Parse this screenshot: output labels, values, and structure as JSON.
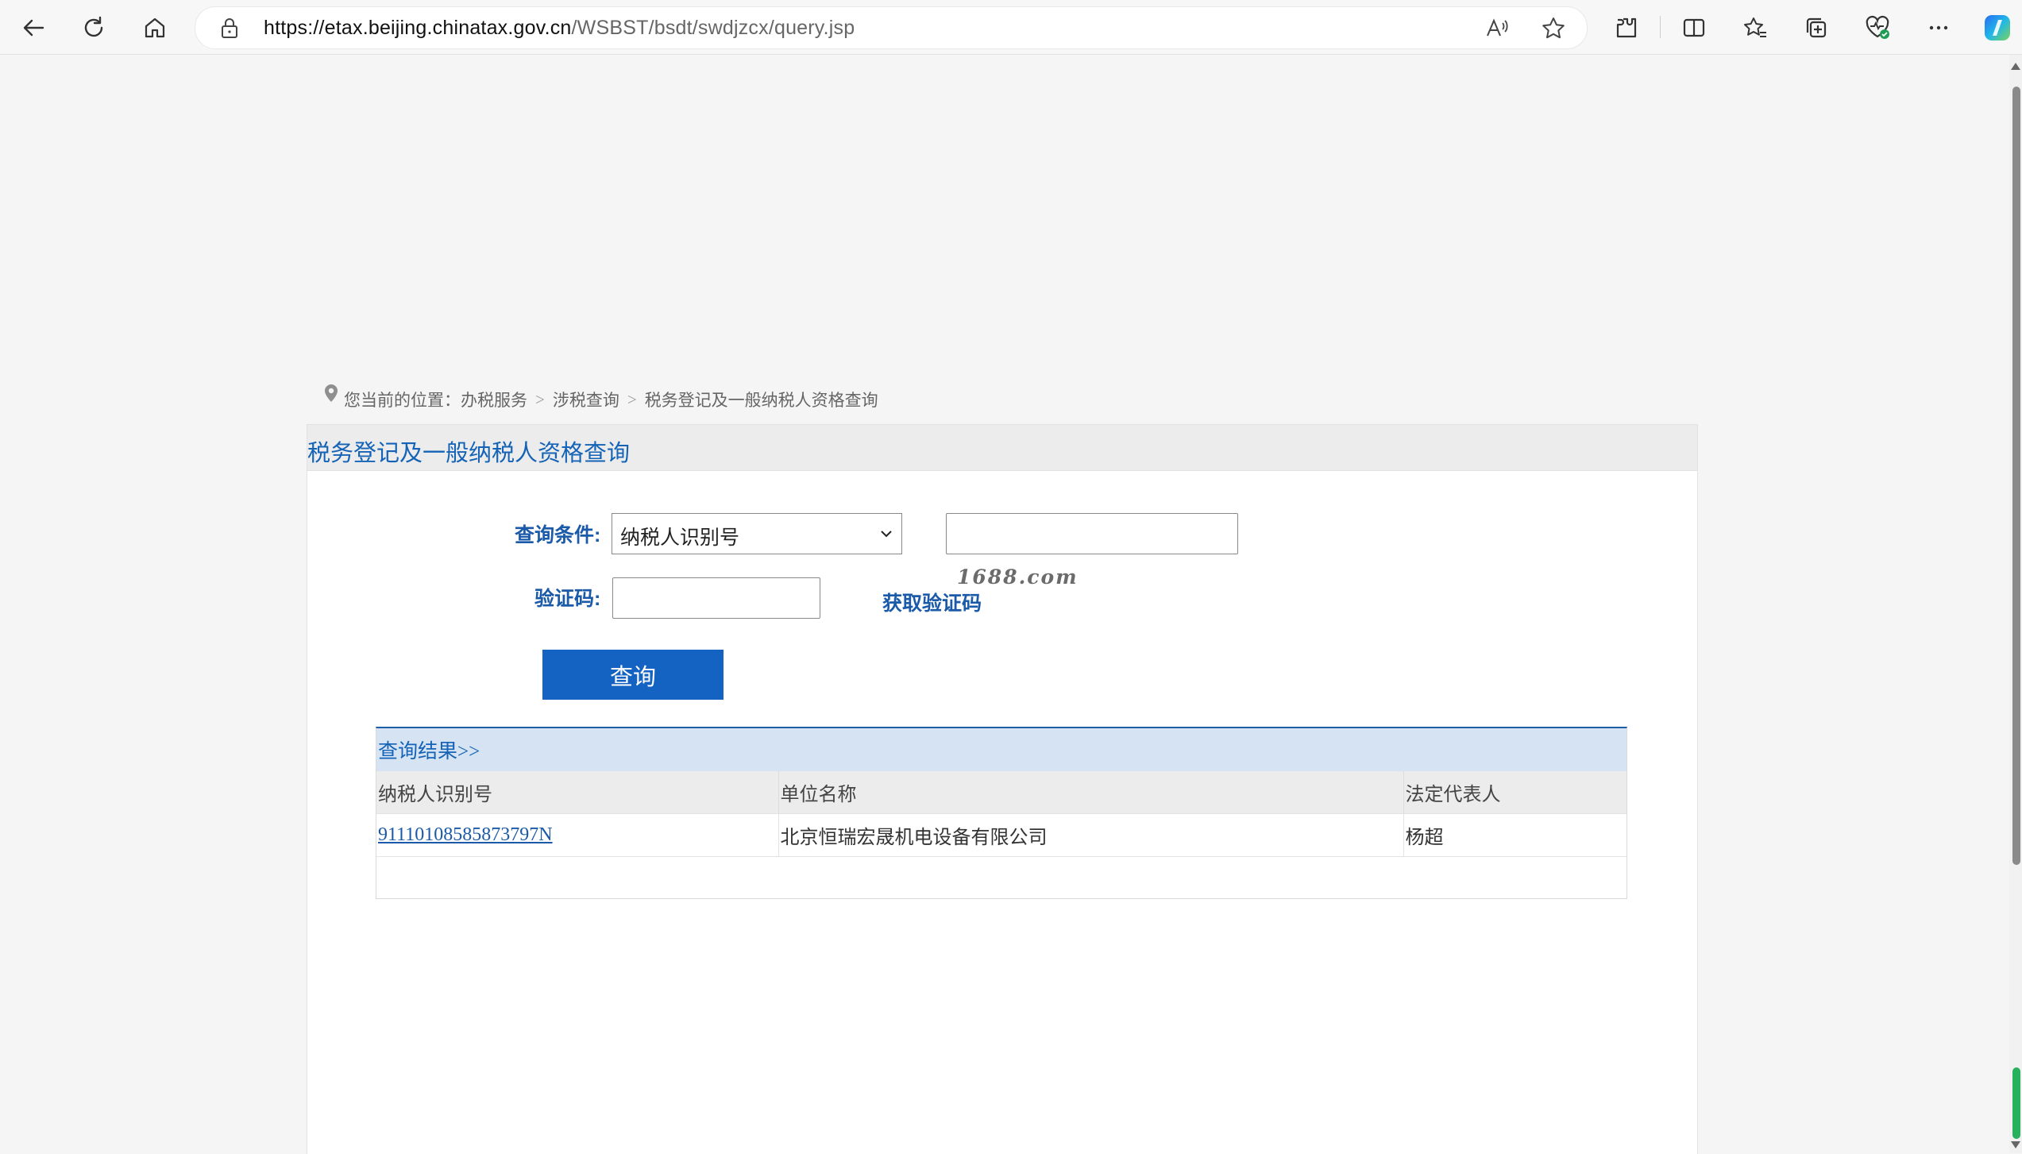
{
  "browser": {
    "url_host": "https://etax.beijing.chinatax.gov.cn",
    "url_path": "/WSBST/bsdt/swdjzcx/query.jsp",
    "icons": [
      "back-icon",
      "refresh-icon",
      "home-icon",
      "lock-icon",
      "read-aloud-icon",
      "favorite-star-icon",
      "extensions-icon",
      "split-screen-icon",
      "favorites-icon",
      "collections-icon",
      "browser-essentials-icon",
      "more-icon",
      "copilot-icon"
    ]
  },
  "breadcrumb": {
    "prefix": "您当前的位置：",
    "items": [
      "办税服务",
      "涉税查询",
      "税务登记及一般纳税人资格查询"
    ]
  },
  "panel": {
    "title": "税务登记及一般纳税人资格查询"
  },
  "form": {
    "condition_label": "查询条件:",
    "condition_selected": "纳税人识别号",
    "condition_value": "",
    "captcha_label": "验证码:",
    "captcha_value": "",
    "captcha_image_text": "1688.com",
    "get_captcha_label": "获取验证码",
    "query_button": "查询"
  },
  "results": {
    "header": "查询结果>>",
    "columns": [
      "纳税人识别号",
      "单位名称",
      "法定代表人"
    ],
    "rows": [
      {
        "tax_id": "91110108585873797N",
        "company": "北京恒瑞宏晟机电设备有限公司",
        "legal_rep": "杨超"
      }
    ]
  },
  "colors": {
    "accent": "#1462c2",
    "title_blue": "#1463b6",
    "result_header_bg": "#d5e3f3"
  }
}
